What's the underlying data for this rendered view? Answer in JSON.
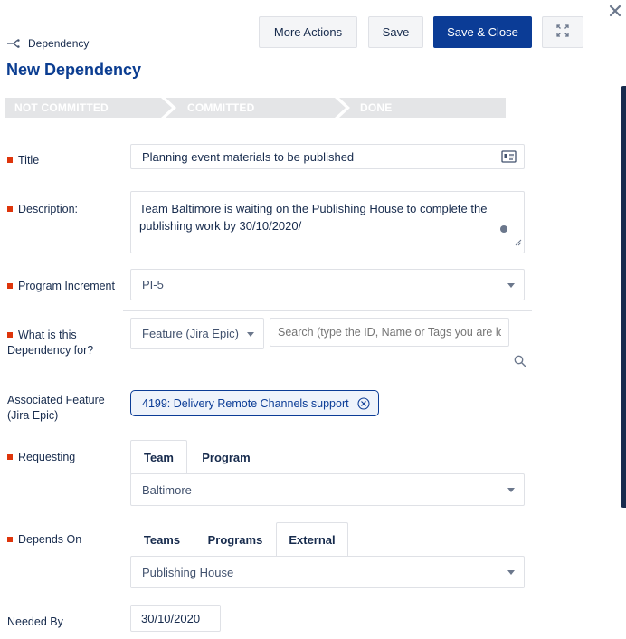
{
  "header": {
    "breadcrumb": "Dependency",
    "title": "New Dependency"
  },
  "toolbar": {
    "more_actions": "More Actions",
    "save": "Save",
    "save_close": "Save & Close"
  },
  "workflow": [
    "NOT COMMITTED",
    "COMMITTED",
    "DONE"
  ],
  "form": {
    "title": {
      "label": "Title",
      "value": "Planning event materials to be published"
    },
    "description": {
      "label": "Description:",
      "value": "Team Baltimore is waiting on the Publishing House to complete the publishing work by 30/10/2020/"
    },
    "program_increment": {
      "label": "Program Increment",
      "value": "PI-5"
    },
    "dependency_for": {
      "label_line1": "What is this",
      "label_line2": "Dependency for?",
      "type_value": "Feature (Jira Epic)",
      "search_placeholder": "Search (type the ID, Name or Tags you are looking for)"
    },
    "associated_feature": {
      "label_line1": "Associated Feature",
      "label_line2": "(Jira Epic)",
      "chip": "4199: Delivery Remote Channels support"
    },
    "requesting": {
      "label": "Requesting",
      "tabs": [
        "Team",
        "Program"
      ],
      "active_tab": "Team",
      "value": "Baltimore"
    },
    "depends_on": {
      "label": "Depends On",
      "tabs": [
        "Teams",
        "Programs",
        "External"
      ],
      "active_tab": "External",
      "value": "Publishing House"
    },
    "needed_by": {
      "label": "Needed By",
      "value": "30/10/2020"
    }
  },
  "colors": {
    "primary": "#0b3c96",
    "title": "#0b3d91",
    "required": "#de350b",
    "workflow_bg": "#e4e5e7"
  }
}
